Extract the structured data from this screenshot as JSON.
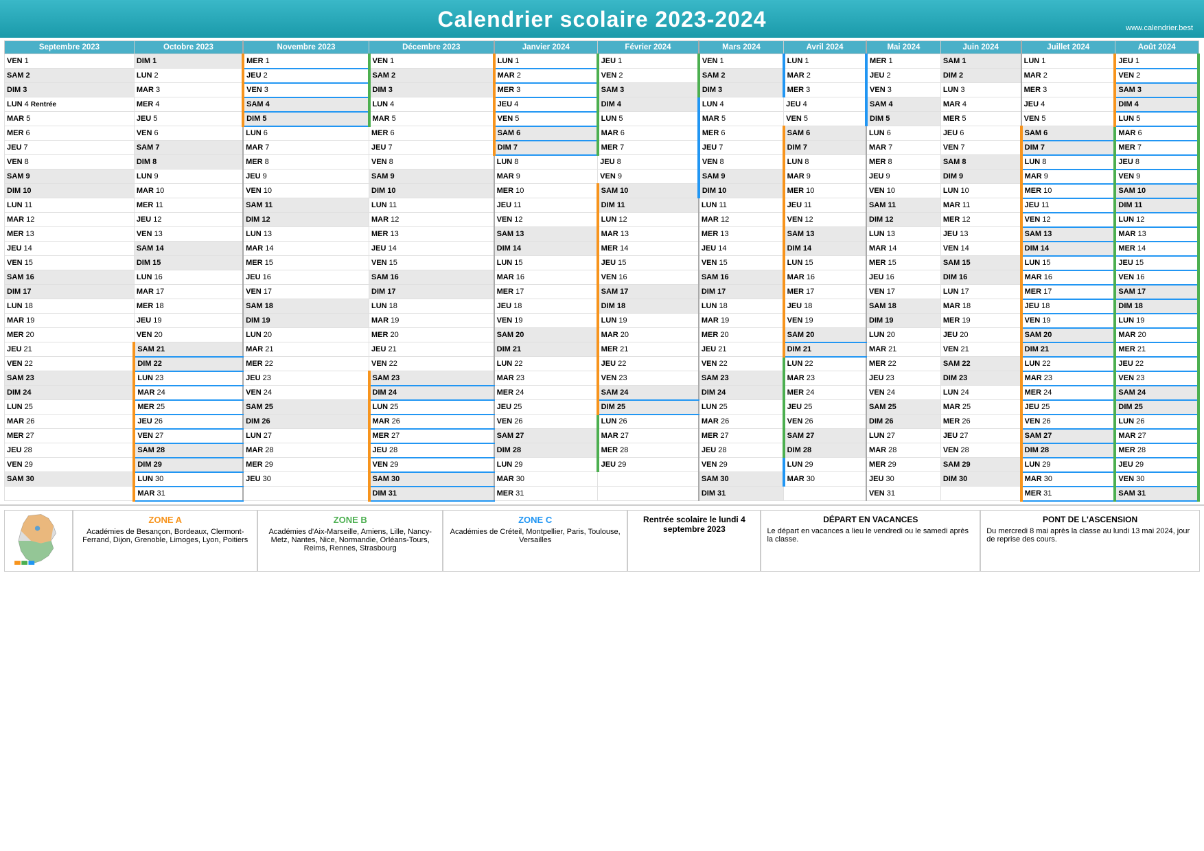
{
  "header": {
    "title": "Calendrier scolaire 2023-2024",
    "website": "www.calendrier.best"
  },
  "months": [
    {
      "key": "sep2023",
      "label": "Septembre 2023",
      "thClass": "th-sep2023"
    },
    {
      "key": "oct2023",
      "label": "Octobre 2023",
      "thClass": "th-oct2023"
    },
    {
      "key": "nov2023",
      "label": "Novembre 2023",
      "thClass": "th-nov2023"
    },
    {
      "key": "dec2023",
      "label": "Décembre 2023",
      "thClass": "th-dec2023"
    },
    {
      "key": "jan2024",
      "label": "Janvier 2024",
      "thClass": "th-jan2024"
    },
    {
      "key": "feb2024",
      "label": "Février 2024",
      "thClass": "th-feb2024"
    },
    {
      "key": "mar2024",
      "label": "Mars 2024",
      "thClass": "th-mar2024"
    },
    {
      "key": "apr2024",
      "label": "Avril 2024",
      "thClass": "th-apr2024"
    },
    {
      "key": "may2024",
      "label": "Mai 2024",
      "thClass": "th-may2024"
    },
    {
      "key": "jun2024",
      "label": "Juin 2024",
      "thClass": "th-jun2024"
    },
    {
      "key": "jul2024",
      "label": "Juillet 2024",
      "thClass": "th-jul2024"
    },
    {
      "key": "aug2024",
      "label": "Août 2024",
      "thClass": "th-aug2024"
    }
  ],
  "footer": {
    "zone_a_title": "ZONE A",
    "zone_a_text": "Académies de Besançon, Bordeaux, Clermont-Ferrand, Dijon, Grenoble, Limoges, Lyon, Poitiers",
    "zone_b_title": "ZONE B",
    "zone_b_text": "Académies d'Aix-Marseille, Amiens, Lille, Nancy-Metz, Nantes, Nice, Normandie, Orléans-Tours, Reims, Rennes, Strasbourg",
    "zone_c_title": "ZONE C",
    "zone_c_text": "Académies de Créteil, Montpellier, Paris, Toulouse, Versailles",
    "rentree_title": "Rentrée scolaire le lundi 4 septembre 2023",
    "depart_title": "DÉPART EN VACANCES",
    "depart_text": "Le départ en vacances a lieu le vendredi ou le samedi après la classe.",
    "ascension_title": "PONT DE L'ASCENSION",
    "ascension_text": "Du mercredi 8 mai après la classe au lundi 13 mai 2024, jour de reprise des cours."
  }
}
